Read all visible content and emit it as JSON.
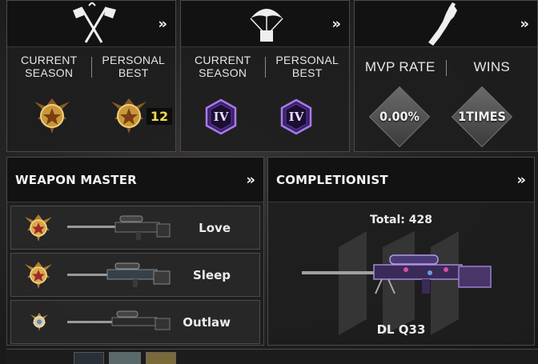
{
  "season_panel": {
    "labels": [
      "CURRENT SEASON",
      "PERSONAL BEST"
    ],
    "best_level": "12"
  },
  "ranked_panel": {
    "labels": [
      "CURRENT SEASON",
      "PERSONAL BEST"
    ],
    "current_rank": "IV",
    "best_rank": "IV"
  },
  "mvp_panel": {
    "labels": [
      "MVP RATE",
      "WINS"
    ],
    "mvp_rate": "0.00%",
    "wins": "1TIMES"
  },
  "weapon_master": {
    "title": "WEAPON MASTER",
    "weapons": [
      {
        "name": "Love"
      },
      {
        "name": "Sleep"
      },
      {
        "name": "Outlaw"
      }
    ]
  },
  "completionist": {
    "title": "COMPLETIONIST",
    "total": "Total: 428",
    "weapon_name": "DL Q33"
  },
  "icons": {
    "chevron": "»",
    "colors": {
      "gold": "#c9973a",
      "purple": "#7b4bc4",
      "yellow_num": "#f4d94a"
    }
  }
}
